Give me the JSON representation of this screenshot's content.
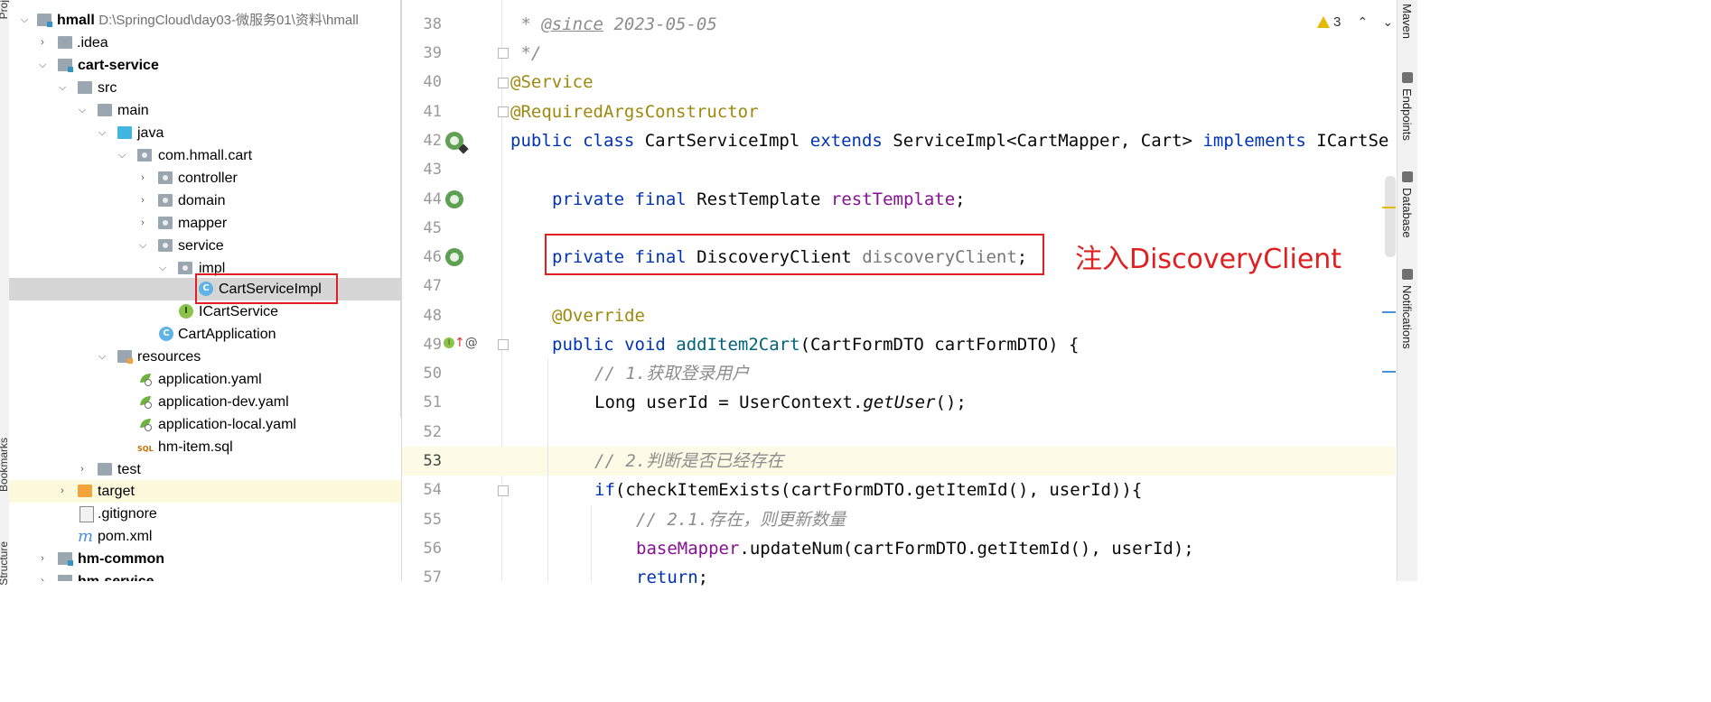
{
  "side_tabs": {
    "left_top": "Proj",
    "left_bookmarks": "Bookmarks",
    "left_structure": "Structure"
  },
  "tree": {
    "root": {
      "name": "hmall",
      "path": "D:\\SpringCloud\\day03-微服务01\\资料\\hmall"
    },
    "nodes": [
      {
        "label": "hmall",
        "hint": "D:\\SpringCloud\\day03-微服务01\\资料\\hmall",
        "icon": "module-folder-icon",
        "arrow": "open"
      },
      {
        "label": ".idea",
        "icon": "folder-icon",
        "arrow": "closed"
      },
      {
        "label": "cart-service",
        "icon": "module-folder-icon",
        "arrow": "open"
      },
      {
        "label": "src",
        "icon": "folder-icon",
        "arrow": "open"
      },
      {
        "label": "main",
        "icon": "folder-icon",
        "arrow": "open"
      },
      {
        "label": "java",
        "icon": "source-folder-icon",
        "arrow": "open"
      },
      {
        "label": "com.hmall.cart",
        "icon": "package-icon",
        "arrow": "open"
      },
      {
        "label": "controller",
        "icon": "package-icon",
        "arrow": "closed"
      },
      {
        "label": "domain",
        "icon": "package-icon",
        "arrow": "closed"
      },
      {
        "label": "mapper",
        "icon": "package-icon",
        "arrow": "closed"
      },
      {
        "label": "service",
        "icon": "package-icon",
        "arrow": "open"
      },
      {
        "label": "impl",
        "icon": "package-icon",
        "arrow": "open"
      },
      {
        "label": "CartServiceImpl",
        "icon": "class-icon",
        "arrow": "none"
      },
      {
        "label": "ICartService",
        "icon": "interface-icon",
        "arrow": "none"
      },
      {
        "label": "CartApplication",
        "icon": "spring-class-icon",
        "arrow": "none"
      },
      {
        "label": "resources",
        "icon": "resources-folder-icon",
        "arrow": "open"
      },
      {
        "label": "application.yaml",
        "icon": "yaml-icon",
        "arrow": "none"
      },
      {
        "label": "application-dev.yaml",
        "icon": "yaml-icon",
        "arrow": "none"
      },
      {
        "label": "application-local.yaml",
        "icon": "yaml-icon",
        "arrow": "none"
      },
      {
        "label": "hm-item.sql",
        "icon": "sql-icon",
        "arrow": "none"
      },
      {
        "label": "test",
        "icon": "folder-icon",
        "arrow": "closed"
      },
      {
        "label": "target",
        "icon": "excluded-folder-icon",
        "arrow": "closed"
      },
      {
        "label": ".gitignore",
        "icon": "gitignore-icon",
        "arrow": "none"
      },
      {
        "label": "pom.xml",
        "icon": "maven-icon",
        "arrow": "none"
      },
      {
        "label": "hm-common",
        "icon": "module-folder-icon",
        "arrow": "closed"
      },
      {
        "label": "hm-service",
        "icon": "module-folder-icon",
        "arrow": "closed"
      }
    ]
  },
  "editor": {
    "line_numbers": [
      "38",
      "39",
      "40",
      "41",
      "42",
      "43",
      "44",
      "45",
      "46",
      "47",
      "48",
      "49",
      "50",
      "51",
      "52",
      "53",
      "54",
      "55",
      "56",
      "57"
    ],
    "current_line": "53",
    "lines": {
      "l38_star": " * ",
      "l38_tag": "@since",
      "l38_rest": " 2023-05-05",
      "l39": " */",
      "l40": "@Service",
      "l41": "@RequiredArgsConstructor",
      "l42_kw1": "public class ",
      "l42_name": "CartServiceImpl ",
      "l42_kw2": "extends ",
      "l42_super": "ServiceImpl<CartMapper, Cart> ",
      "l42_kw3": "implements ",
      "l42_iface": "ICartSe",
      "l44_kw": "private final ",
      "l44_type": "RestTemplate ",
      "l44_field": "restTemplate",
      "l44_end": ";",
      "l46_kw": "private final ",
      "l46_type": "DiscoveryClient ",
      "l46_field": "discoveryClient",
      "l46_end": ";",
      "l48": "@Override",
      "l49_kw": "public void ",
      "l49_meth": "addItem2Cart",
      "l49_rest": "(CartFormDTO cartFormDTO) {",
      "l50": "// 1.获取登录用户",
      "l51_a": "Long userId = UserContext.",
      "l51_b": "getUser",
      "l51_c": "();",
      "l53": "// 2.判断是否已经存在",
      "l54_kw": "if",
      "l54_rest": "(checkItemExists(cartFormDTO.getItemId(), userId)){",
      "l55": "// 2.1.存在，则更新数量",
      "l56_field": "baseMapper",
      "l56_rest": ".updateNum(cartFormDTO.getItemId(), userId);",
      "l57_kw": "return",
      "l57_end": ";"
    }
  },
  "annotation": {
    "text": "注入DiscoveryClient"
  },
  "inspections": {
    "warnings": "3"
  },
  "right_tabs": {
    "maven": "Maven",
    "endpoints": "Endpoints",
    "database": "Database",
    "notifications": "Notifications"
  },
  "colors": {
    "keyword": "#0033b3",
    "annotation": "#9e880d",
    "field": "#871094",
    "comment": "#8c8c8c",
    "highlight_box": "#e02020"
  }
}
